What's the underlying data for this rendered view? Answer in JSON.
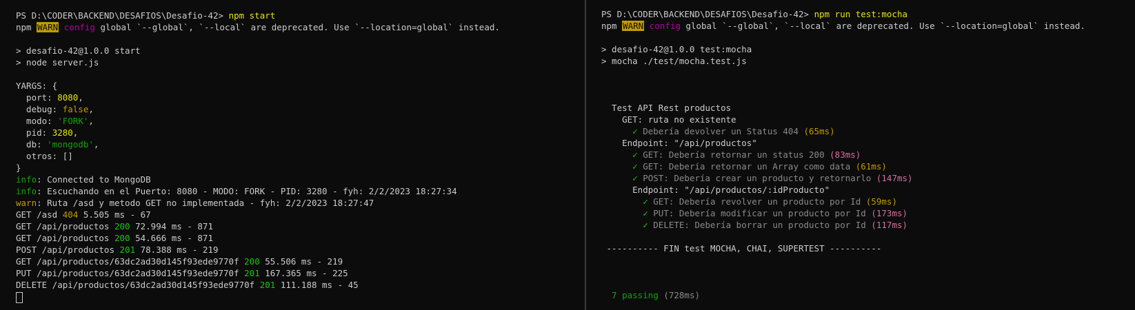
{
  "colors": {
    "background": "#0c0c0c",
    "foreground": "#cccccc",
    "warn_badge": "#c19c00",
    "pass": "#13a10e",
    "fast": "#c19c00",
    "slow": "#d6709f"
  },
  "left": {
    "prompt": "PS D:\\CODER\\BACKEND\\DESAFIOS\\Desafio-42>",
    "command": "npm start",
    "warn": {
      "prefix": "npm",
      "badge": "WARN",
      "config": "config",
      "message": "global `--global`, `--local` are deprecated. Use `--location=global` instead."
    },
    "script_lines": [
      "> desafio-42@1.0.0 start",
      "> node server.js"
    ],
    "yargs": {
      "open": "YARGS: {",
      "port_key": "  port: ",
      "port_val": "8080",
      "port_comma": ",",
      "debug_key": "  debug: ",
      "debug_val": "false",
      "debug_comma": ",",
      "modo_key": "  modo: ",
      "modo_val": "'FORK'",
      "modo_comma": ",",
      "pid_key": "  pid: ",
      "pid_val": "3280",
      "pid_comma": ",",
      "db_key": "  db: ",
      "db_val": "'mongodb'",
      "db_comma": ",",
      "otros": "  otros: []",
      "close": "}"
    },
    "logs": [
      {
        "level": "info",
        "text": ": Connected to MongoDB"
      },
      {
        "level": "info",
        "text": ": Escuchando en el Puerto: 8080 - MODO: FORK - PID: 3280 - fyh: 2/2/2023 18:27:34"
      },
      {
        "level": "warn",
        "text": ": Ruta /asd y metodo GET no implementada - fyh: 2/2/2023 18:27:47"
      }
    ],
    "requests": [
      {
        "path": "GET /asd ",
        "status": "404",
        "rest": " 5.505 ms - 67"
      },
      {
        "path": "GET /api/productos ",
        "status": "200",
        "rest": " 72.994 ms - 871"
      },
      {
        "path": "GET /api/productos ",
        "status": "200",
        "rest": " 54.666 ms - 871"
      },
      {
        "path": "POST /api/productos ",
        "status": "201",
        "rest": " 78.388 ms - 219"
      },
      {
        "path": "GET /api/productos/63dc2ad30d145f93ede9770f ",
        "status": "200",
        "rest": " 55.506 ms - 219"
      },
      {
        "path": "PUT /api/productos/63dc2ad30d145f93ede9770f ",
        "status": "201",
        "rest": " 167.365 ms - 225"
      },
      {
        "path": "DELETE /api/productos/63dc2ad30d145f93ede9770f ",
        "status": "201",
        "rest": " 111.188 ms - 45"
      }
    ]
  },
  "right": {
    "prompt": "PS D:\\CODER\\BACKEND\\DESAFIOS\\Desafio-42>",
    "command": "npm run test:mocha",
    "warn": {
      "prefix": "npm",
      "badge": "WARN",
      "config": "config",
      "message": "global `--global`, `--local` are deprecated. Use `--location=global` instead."
    },
    "script_lines": [
      "> desafio-42@1.0.0 test:mocha",
      "> mocha ./test/mocha.test.js"
    ],
    "suite_title": "  Test API Rest productos",
    "group1": "    GET: ruta no existente",
    "group1_tests": [
      {
        "indent": "      ",
        "text": " Debería devolver un Status 404 ",
        "time": "(65ms)",
        "speed": "fast"
      }
    ],
    "group2": "    Endpoint: \"/api/productos\"",
    "group2_tests": [
      {
        "indent": "      ",
        "text": " GET: Debería retornar un status 200 ",
        "time": "(83ms)",
        "speed": "slow"
      },
      {
        "indent": "      ",
        "text": " GET: Debería retornar un Array como data ",
        "time": "(61ms)",
        "speed": "fast"
      },
      {
        "indent": "      ",
        "text": " POST: Debería crear un producto y retornarlo ",
        "time": "(147ms)",
        "speed": "slow"
      }
    ],
    "group3": "      Endpoint: \"/api/productos/:idProducto\"",
    "group3_tests": [
      {
        "indent": "        ",
        "text": " GET: Debería revolver un producto por Id ",
        "time": "(59ms)",
        "speed": "fast"
      },
      {
        "indent": "        ",
        "text": " PUT: Debería modificar un producto por Id ",
        "time": "(173ms)",
        "speed": "slow"
      },
      {
        "indent": "        ",
        "text": " DELETE: Debería borrar un producto por Id ",
        "time": "(117ms)",
        "speed": "slow"
      }
    ],
    "check_glyph": "✓",
    "footer": " ---------- FIN test MOCHA, CHAI, SUPERTEST ----------",
    "passing": "  7 passing",
    "passing_time": " (728ms)"
  }
}
